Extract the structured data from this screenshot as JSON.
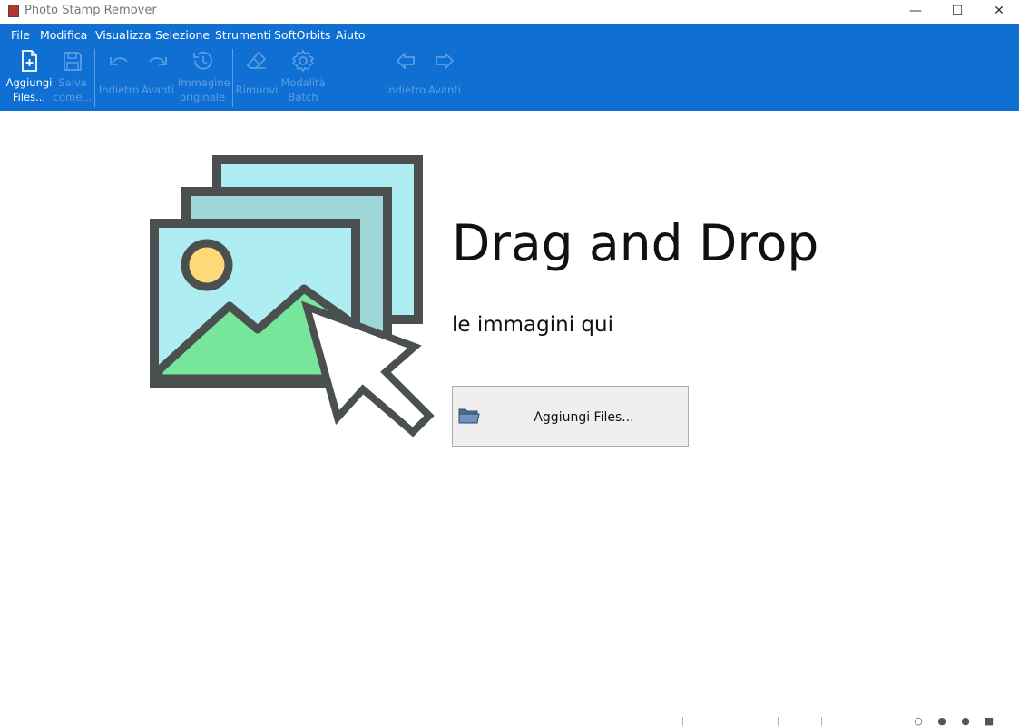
{
  "window": {
    "title": "Photo Stamp Remover",
    "min_glyph": "—",
    "max_glyph": "☐",
    "close_glyph": "✕"
  },
  "menu": [
    "File",
    "Modifica",
    "Visualizza",
    "Selezione",
    "Strumenti",
    "SoftOrbits",
    "Aiuto"
  ],
  "toolbar": {
    "add_files": [
      "Aggiungi",
      "Files..."
    ],
    "save_as": [
      "Salva",
      "come..."
    ],
    "undo": "Indietro",
    "redo": "Avanti",
    "original": [
      "Immagine",
      "originale"
    ],
    "remove": "Rimuovi",
    "batch": [
      "Modalità",
      "Batch"
    ],
    "prev": "Indietro",
    "next": "Avanti"
  },
  "main": {
    "heading": "Drag and Drop",
    "subheading": "le immagini qui",
    "add_button_label": "Aggiungi Files..."
  },
  "colors": {
    "ribbon": "#0f6fd2",
    "disabled_text": "#5b9ee3",
    "button_bg": "#efefef"
  },
  "icons": [
    "app-icon",
    "add-file-icon",
    "save-icon",
    "undo-icon",
    "redo-icon",
    "history-icon",
    "eraser-icon",
    "gear-icon",
    "arrow-left-icon",
    "arrow-right-icon",
    "folder-icon",
    "photos-illustration",
    "cursor-arrow-icon"
  ]
}
